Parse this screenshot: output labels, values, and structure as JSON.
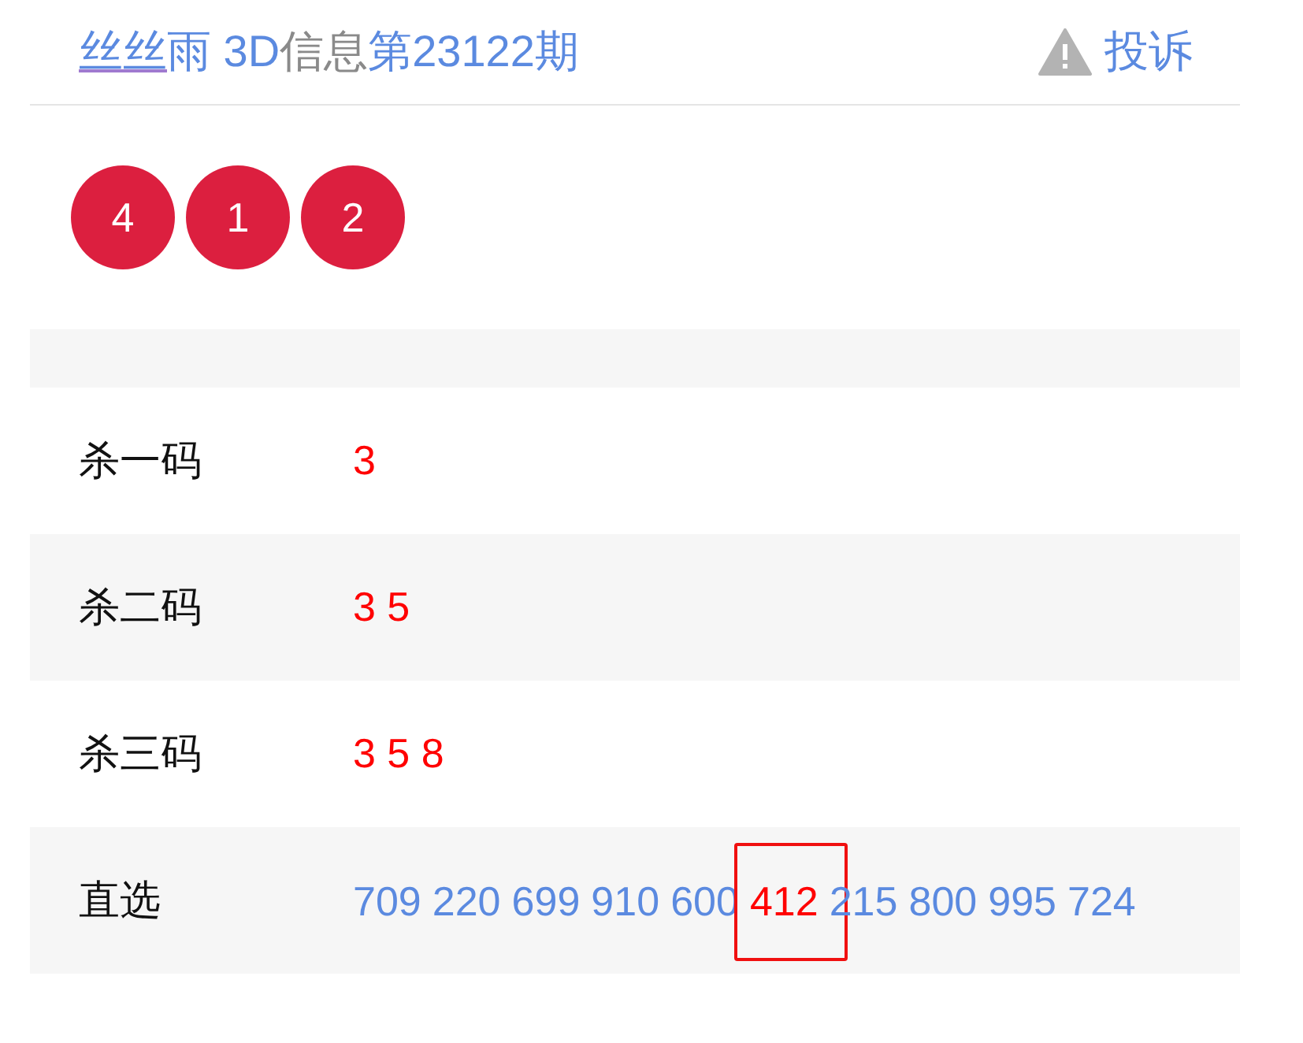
{
  "header": {
    "title": [
      {
        "text": "丝丝",
        "kind": "link"
      },
      {
        "text": "雨 3D",
        "kind": "accent"
      },
      {
        "text": "信息",
        "kind": "muted"
      },
      {
        "text": "第23122期",
        "kind": "accent"
      }
    ],
    "complaint": "投诉"
  },
  "balls": [
    "4",
    "1",
    "2"
  ],
  "rows": [
    {
      "label": "杀一码",
      "kind": "kill",
      "value": "3"
    },
    {
      "label": "杀二码",
      "kind": "kill",
      "value": "3 5"
    },
    {
      "label": "杀三码",
      "kind": "kill",
      "value": "3 5 8"
    },
    {
      "label": "直选",
      "kind": "numbers",
      "numbers": [
        {
          "text": "709",
          "hit": false
        },
        {
          "text": "220",
          "hit": false
        },
        {
          "text": "699",
          "hit": false
        },
        {
          "text": "910",
          "hit": false
        },
        {
          "text": "600",
          "hit": false
        },
        {
          "text": "412",
          "hit": true
        },
        {
          "text": "215",
          "hit": false
        },
        {
          "text": "800",
          "hit": false
        },
        {
          "text": "995",
          "hit": false
        },
        {
          "text": "724",
          "hit": false
        }
      ]
    }
  ]
}
